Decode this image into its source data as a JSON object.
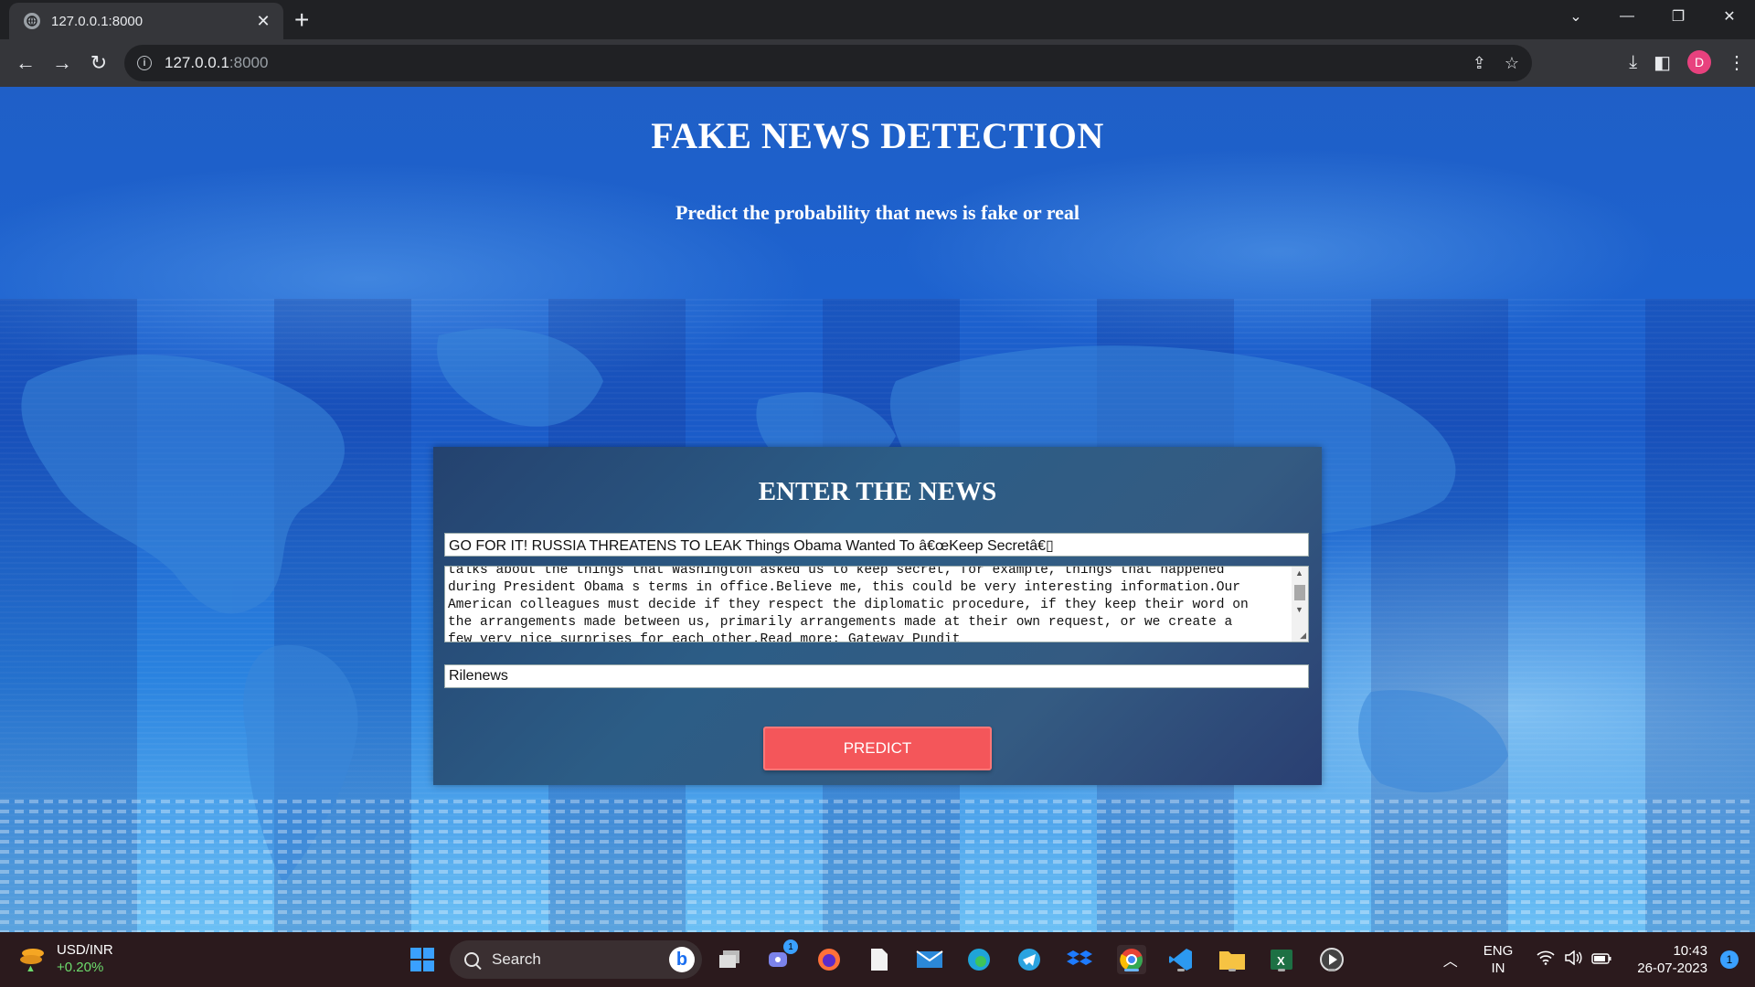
{
  "browser": {
    "tab_title": "127.0.0.1:8000",
    "url_host": "127.0.0.1",
    "url_port": ":8000",
    "profile_initial": "D"
  },
  "page": {
    "heading": "FAKE NEWS DETECTION",
    "subheading": "Predict the probability that news is fake or real",
    "form": {
      "title": "ENTER THE NEWS",
      "news_title_value": "GO FOR IT! RUSSIA THREATENS TO LEAK Things Obama Wanted To â€œKeep Secretâ€▯",
      "news_text_lines": [
        "talks about the things that Washington asked us to keep secret, for example, things that happened",
        "during President Obama s terms in office.Believe me, this could be very interesting information.Our",
        "American colleagues must decide if they respect the diplomatic procedure, if they keep their word on",
        "the arrangements made between us, primarily arrangements made at their own request, or we create a",
        "few very nice surprises for each other.Read more: Gateway Pundit"
      ],
      "author_value": "Rilenews",
      "predict_label": "PREDICT"
    }
  },
  "taskbar": {
    "widget_label": "USD/INR",
    "widget_change": "+0.20%",
    "search_placeholder": "Search",
    "lang_line1": "ENG",
    "lang_line2": "IN",
    "time": "10:43",
    "date": "26-07-2023",
    "notification_count": "1",
    "teams_badge": "1"
  },
  "colors": {
    "predict_button": "#f4565a",
    "card_background": "#2c5d86",
    "page_background": "#1d62cf"
  }
}
